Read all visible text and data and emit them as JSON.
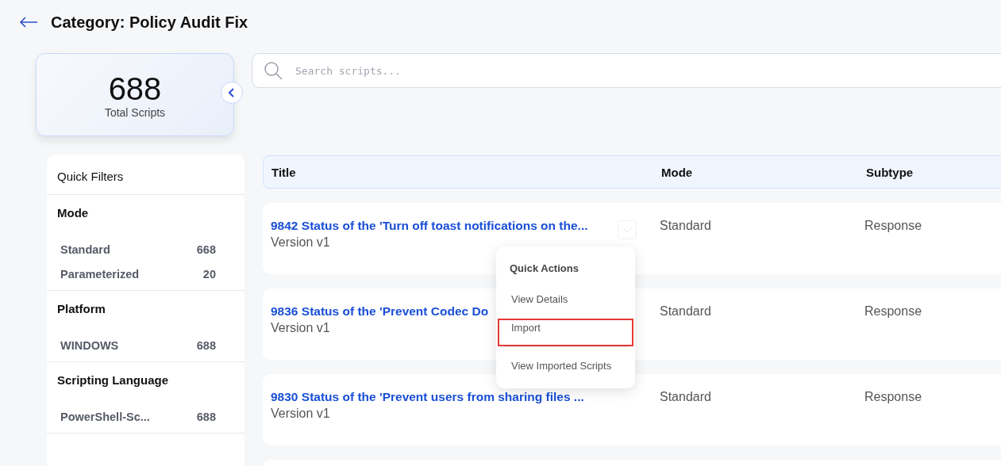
{
  "header": {
    "title": "Category: Policy Audit Fix"
  },
  "summary": {
    "count": "688",
    "label": "Total Scripts"
  },
  "search": {
    "placeholder": "Search scripts..."
  },
  "filters": {
    "title": "Quick Filters",
    "groups": [
      {
        "title": "Mode",
        "items": [
          {
            "label": "Standard",
            "count": "668"
          },
          {
            "label": "Parameterized",
            "count": "20"
          }
        ]
      },
      {
        "title": "Platform",
        "items": [
          {
            "label": "WINDOWS",
            "count": "688"
          }
        ]
      },
      {
        "title": "Scripting Language",
        "items": [
          {
            "label": "PowerShell-Sc...",
            "count": "688"
          }
        ]
      }
    ]
  },
  "table": {
    "columns": [
      "Title",
      "Mode",
      "Subtype"
    ],
    "rows": [
      {
        "title": "9842 Status of the 'Turn off toast notifications on the...",
        "version": "Version v1",
        "mode": "Standard",
        "subtype": "Response",
        "menu_open": true
      },
      {
        "title": "9836 Status of the 'Prevent Codec Do",
        "version": "Version v1",
        "mode": "Standard",
        "subtype": "Response",
        "menu_open": false
      },
      {
        "title": "9830 Status of the 'Prevent users from sharing files ...",
        "version": "Version v1",
        "mode": "Standard",
        "subtype": "Response",
        "menu_open": false
      }
    ]
  },
  "quick_actions": {
    "title": "Quick Actions",
    "items": [
      {
        "label": "View Details",
        "highlighted": false
      },
      {
        "label": "Import",
        "highlighted": true
      },
      {
        "label": "View Imported Scripts",
        "highlighted": false
      }
    ]
  }
}
